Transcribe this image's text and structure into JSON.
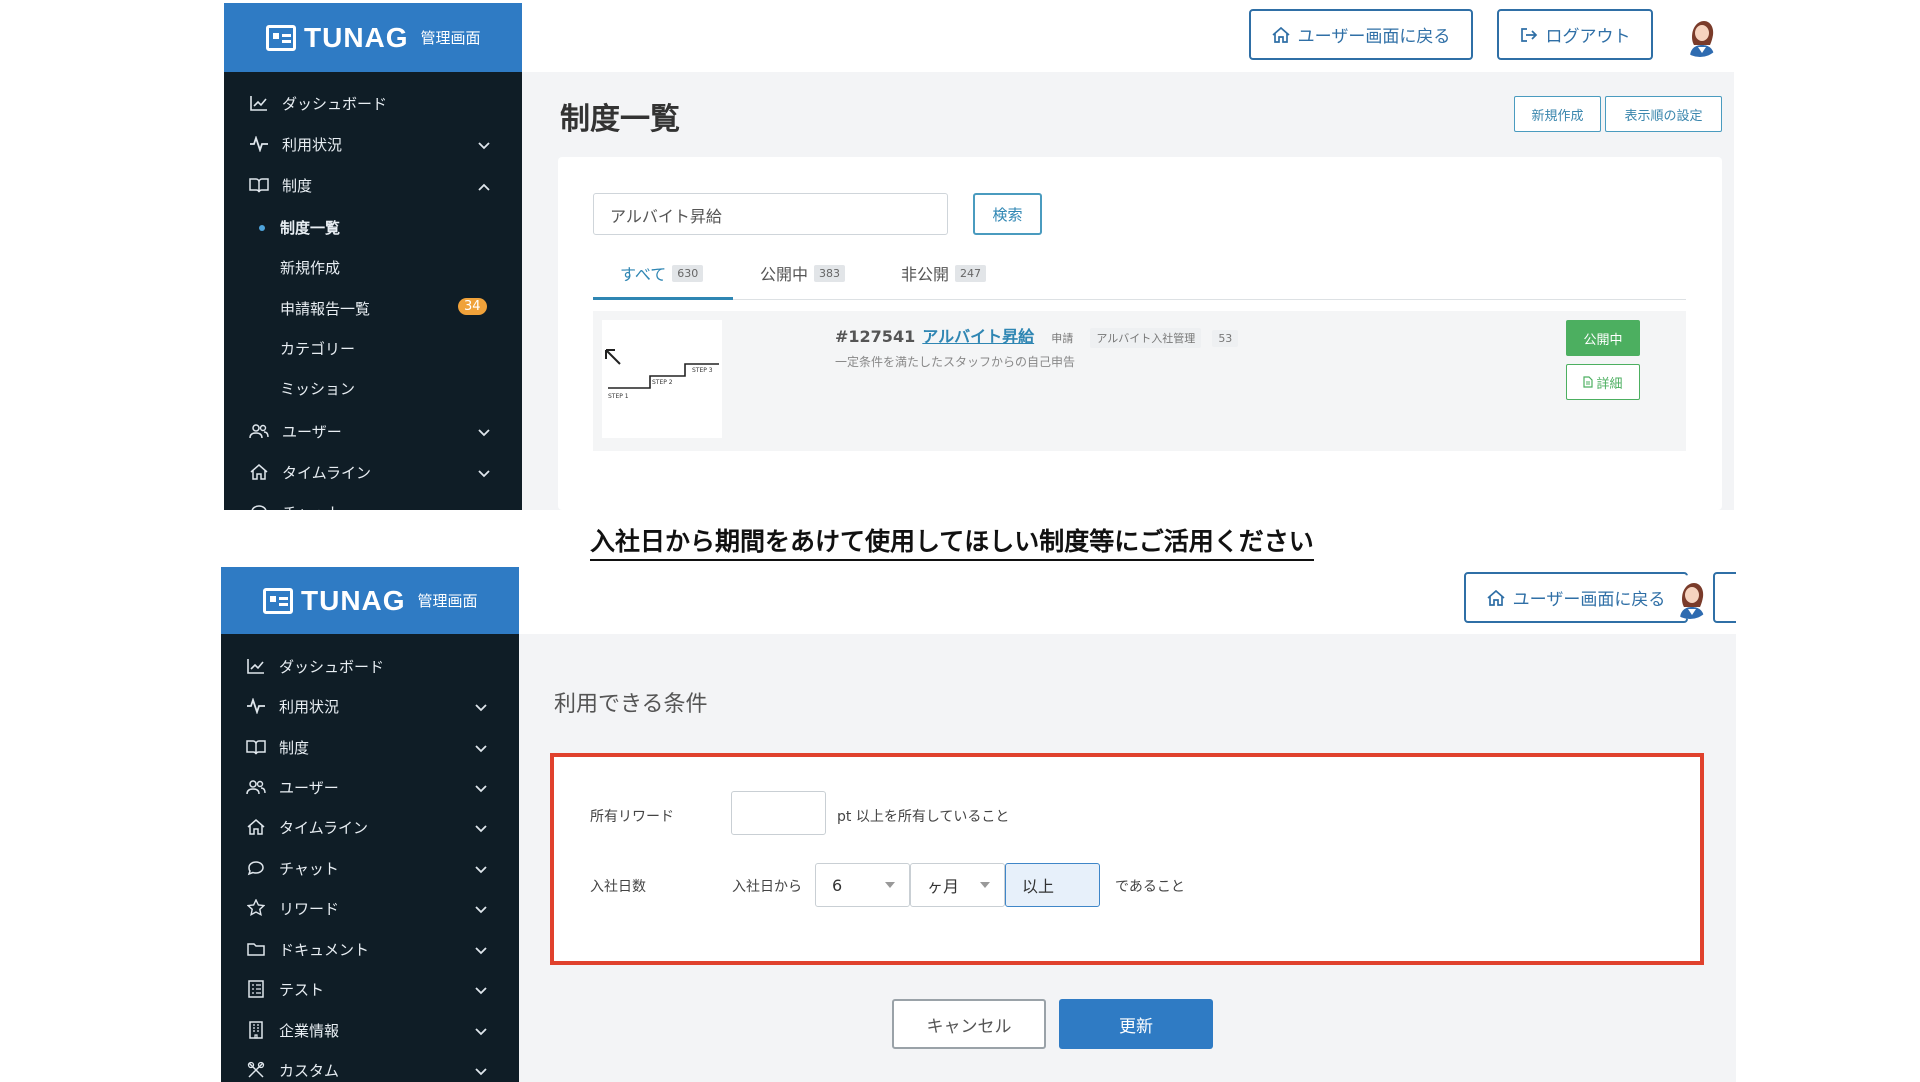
{
  "brand": {
    "logo": "TUNAG",
    "subtitle": "管理画面"
  },
  "header": {
    "back_label": "ユーザー画面に戻る",
    "logout_label": "ログアウト"
  },
  "top": {
    "sidebar": {
      "items": [
        {
          "label": "ダッシュボード",
          "icon": "chart-icon"
        },
        {
          "label": "利用状況",
          "icon": "pulse-icon"
        },
        {
          "label": "制度",
          "icon": "book-icon"
        }
      ],
      "sub_items": [
        {
          "label": "制度一覧"
        },
        {
          "label": "新規作成"
        },
        {
          "label": "申請報告一覧",
          "badge": "34"
        },
        {
          "label": "カテゴリー"
        },
        {
          "label": "ミッション"
        }
      ],
      "items_after": [
        {
          "label": "ユーザー",
          "icon": "users-icon"
        },
        {
          "label": "タイムライン",
          "icon": "home-icon"
        },
        {
          "label": "チャット",
          "icon": "chat-icon"
        }
      ]
    },
    "page_title": "制度一覧",
    "new_button": "新規作成",
    "order_button": "表示順の設定",
    "search": {
      "value": "アルバイト昇給",
      "button": "検索"
    },
    "tabs": [
      {
        "label": "すべて",
        "count": "630"
      },
      {
        "label": "公開中",
        "count": "383"
      },
      {
        "label": "非公開",
        "count": "247"
      }
    ],
    "item": {
      "id": "#127541",
      "title": "アルバイト昇給",
      "tag1": "申請",
      "tag2": "アルバイト入社管理",
      "tag3": "53",
      "description": "一定条件を満たしたスタッフからの自己申告",
      "status": "公開中",
      "detail": "詳細",
      "thumb_steps": [
        "STEP 1",
        "STEP 2",
        "STEP 3"
      ]
    }
  },
  "caption": "入社日から期間をあけて使用してほしい制度等にご活用ください",
  "bottom": {
    "sidebar": {
      "items": [
        {
          "label": "ダッシュボード"
        },
        {
          "label": "利用状況"
        },
        {
          "label": "制度"
        },
        {
          "label": "ユーザー"
        },
        {
          "label": "タイムライン"
        },
        {
          "label": "チャット"
        },
        {
          "label": "リワード"
        },
        {
          "label": "ドキュメント"
        },
        {
          "label": "テスト"
        },
        {
          "label": "企業情報"
        },
        {
          "label": "カスタム"
        }
      ]
    },
    "section_title": "利用できる条件",
    "reward": {
      "label": "所有リワード",
      "value": "",
      "suffix": "pt 以上を所有していること"
    },
    "join": {
      "label": "入社日数",
      "prefix": "入社日から",
      "number": "6",
      "unit": "ヶ月",
      "compare": "以上",
      "suffix": "であること"
    },
    "cancel": "キャンセル",
    "update": "更新"
  },
  "colors": {
    "brand": "#2f7bc4",
    "sidebar": "#0f1d26",
    "highlight": "#e0412d",
    "success": "#4caf60",
    "primary": "#2f7bc4"
  }
}
